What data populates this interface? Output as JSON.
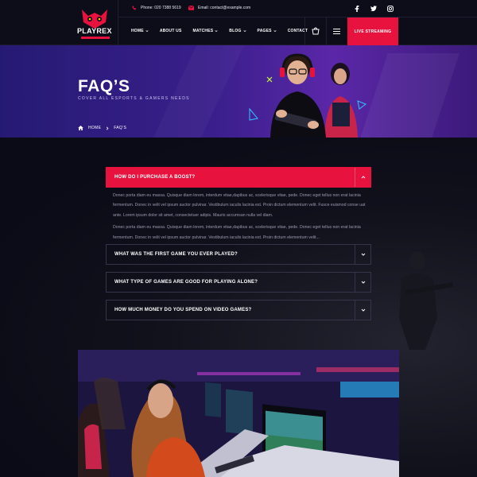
{
  "brand": {
    "name": "PLAYREX"
  },
  "topbar": {
    "phone": "Phone: 020 7388 5619",
    "email": "Email: contact@example.com"
  },
  "social": [
    "facebook-icon",
    "twitter-icon",
    "instagram-icon"
  ],
  "nav": {
    "items": [
      {
        "label": "HOME",
        "dropdown": true
      },
      {
        "label": "ABOUT US",
        "dropdown": false
      },
      {
        "label": "MATCHES",
        "dropdown": true
      },
      {
        "label": "BLOG",
        "dropdown": true
      },
      {
        "label": "PAGES",
        "dropdown": true
      },
      {
        "label": "CONTACT",
        "dropdown": false
      }
    ],
    "cta": "LIVE STREAMING"
  },
  "banner": {
    "title": "FAQ’S",
    "subtitle": "COVER ALL ESPORTS & GAMERS NEEDS",
    "breadcrumb": [
      "HOME",
      "FAQ’S"
    ]
  },
  "faq": {
    "items": [
      {
        "question": "HOW DO I PURCHASE A BOOST?",
        "open": true
      },
      {
        "question": "WHAT WAS THE FIRST GAME YOU EVER PLAYED?",
        "open": false
      },
      {
        "question": "WHAT TYPE OF GAMES ARE GOOD FOR PLAYING ALONE?",
        "open": false
      },
      {
        "question": "HOW MUCH MONEY DO YOU SPEND ON VIDEO GAMES?",
        "open": false
      }
    ],
    "answer": [
      "Donec porta diam eu massa. Quisque diam lorem, interdum vitae,dapibus ac, scelerisque vitae, pede. Donec eget tellus non erat lacinia fermentum. Donec in velit vel ipsum auctor pulvinar. Vestibulum iaculis lacinia est. Proin dictum elementum velit. Fusce euismod conse uat ante. Lorem ipsum dolor sit amet, consectetuer adipis. Mauris accumsan nulla vel diam.",
      "Donec porta diam eu massa. Quisque diam lorem, interdum vitae,dapibus ac, scelerisque vitae, pede. Donec eget tellus non erat lacinia fermentum. Donec in velit vel ipsum auctor pulvinar. Vestibulum iaculis lacinia est. Proin dictum elementum velit..."
    ]
  },
  "colors": {
    "accent": "#e8123f",
    "background": "#0b0b17",
    "banner": "#3a1f8c"
  }
}
